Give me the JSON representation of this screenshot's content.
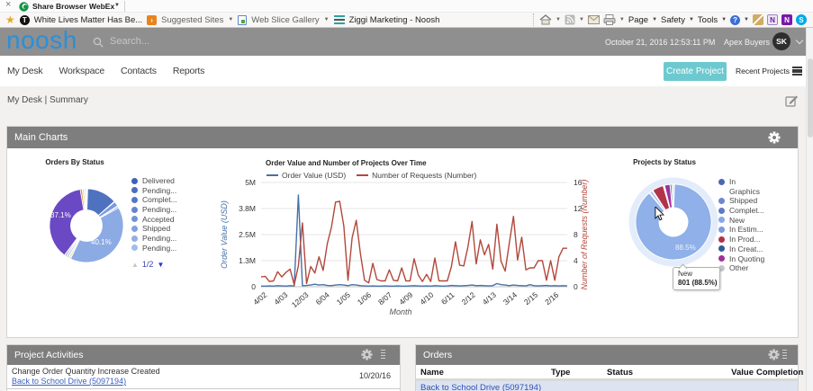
{
  "webex_bar": {
    "close_icon": "×",
    "share_label": "Share Browser",
    "menu_label": "WebEx"
  },
  "favorites_bar": {
    "fav1": "White Lives Matter Has Be...",
    "fav2": "Suggested Sites",
    "fav3": "Web Slice Gallery",
    "fav4": "Ziggi Marketing - Noosh"
  },
  "command_bar": {
    "page": "Page",
    "safety": "Safety",
    "tools": "Tools"
  },
  "app_header": {
    "logo": "noosh",
    "search_placeholder": "Search...",
    "datetime": "October 21, 2016 12:53:11 PM",
    "account": "Apex Buyers",
    "avatar_initials": "SK"
  },
  "nav": {
    "items": [
      {
        "label": "My Desk"
      },
      {
        "label": "Workspace"
      },
      {
        "label": "Contacts"
      },
      {
        "label": "Reports"
      }
    ],
    "create_project": "Create Project",
    "recent_projects": "Recent Projects"
  },
  "breadcrumb": {
    "text": "My Desk | Summary"
  },
  "panels": {
    "main_charts": {
      "title": "Main Charts"
    },
    "project_activities": {
      "title": "Project Activities",
      "rows": [
        {
          "title": "Change Order Quantity Increase Created",
          "link": "Back to School Drive (5097194)",
          "date": "10/20/16"
        }
      ]
    },
    "orders": {
      "title": "Orders",
      "columns": [
        "Name",
        "Type",
        "Status",
        "Value",
        "Completion"
      ],
      "rows": [
        {
          "name": "Back to School Drive (5097194)"
        }
      ]
    }
  },
  "chart_data": [
    {
      "type": "pie",
      "title": "Orders By Status",
      "slices": [
        {
          "from": 2,
          "to": 49,
          "color": "#4e72c0"
        },
        {
          "from": 50,
          "to": 57.5,
          "color": "#7b99dd"
        },
        {
          "from": 58.5,
          "to": 61,
          "color": "#93aee6"
        },
        {
          "from": 61,
          "to": 205.4,
          "color": "#8caae4",
          "label": "40.1%"
        },
        {
          "from": 206.4,
          "to": 208.6,
          "color": "#e3c84b"
        },
        {
          "from": 209.6,
          "to": 212.6,
          "color": "#b9c9ee"
        },
        {
          "from": 213.6,
          "to": 215.6,
          "color": "#3b4f86"
        },
        {
          "from": 216.6,
          "to": 350.2,
          "color": "#6b48c4",
          "label": "37.1%"
        },
        {
          "from": 350.2,
          "to": 353.2,
          "color": "#df8e3c"
        },
        {
          "from": 353.8,
          "to": 356,
          "color": "#e7c84e"
        },
        {
          "from": 356.6,
          "to": 358.6,
          "color": "#cfcfcf"
        }
      ],
      "legend": [
        {
          "label": "Delivered",
          "color": "#3f63b4"
        },
        {
          "label": "Pending...",
          "color": "#4a6fbf"
        },
        {
          "label": "Complet...",
          "color": "#5578c6"
        },
        {
          "label": "Pending...",
          "color": "#6585cf"
        },
        {
          "label": "Accepted",
          "color": "#7493d7"
        },
        {
          "label": "Shipped",
          "color": "#82a0dd"
        },
        {
          "label": "Pending...",
          "color": "#93afe5"
        },
        {
          "label": "Pending...",
          "color": "#a2bceb"
        }
      ],
      "pagination": {
        "page": "1/2"
      }
    },
    {
      "type": "line",
      "title": "Order Value and Number of Projects Over Time",
      "xlabel": "Month",
      "x_labels": [
        "4/02",
        "4/03",
        "12/03",
        "6/04",
        "1/05",
        "1/06",
        "8/07",
        "4/09",
        "4/10",
        "6/11",
        "2/12",
        "4/13",
        "3/14",
        "2/15",
        "2/16"
      ],
      "left_axis": {
        "title": "Order Value (USD)",
        "ticks": [
          "0",
          "1.3M",
          "2.5M",
          "3.8M",
          "5M"
        ],
        "max": 5,
        "color": "#4572a7"
      },
      "right_axis": {
        "title": "Number of Requests (Number)",
        "ticks": [
          "0",
          "4",
          "8",
          "12",
          "16"
        ],
        "max": 16,
        "color": "#b2483c"
      },
      "series": [
        {
          "name": "Order Value (USD)",
          "color": "#4572a7",
          "axis": "left",
          "values": [
            0.03,
            0.03,
            0.04,
            0.03,
            0.05,
            0.04,
            0.03,
            0.05,
            0.04,
            4.4,
            0.05,
            0.06,
            0.08,
            0.12,
            0.08,
            0.1,
            0.06,
            0.05,
            0.08,
            0.1,
            0.08,
            0.05,
            0.1,
            0.08,
            0.05,
            0.04,
            0.03,
            0.04,
            0.03,
            0.03,
            0.04,
            0.03,
            0.03,
            0.04,
            0.03,
            0.03,
            0.04,
            0.05,
            0.04,
            0.03,
            0.04,
            0.03,
            0.05,
            0.04,
            0.03,
            0.04,
            0.06,
            0.05,
            0.04,
            0.05,
            0.06,
            0.08,
            0.05,
            0.06,
            0.05,
            0.04,
            0.05,
            0.15,
            0.1,
            0.08,
            0.05,
            0.08,
            0.06,
            0.05,
            0.04,
            0.1,
            0.05,
            0.04,
            0.05,
            0.06,
            0.04,
            0.05,
            0.04,
            0.05,
            0.04
          ]
        },
        {
          "name": "Number of Requests (Number)",
          "color": "#b2483c",
          "axis": "right",
          "values": [
            1.5,
            1.6,
            0.8,
            0.9,
            2.3,
            1.5,
            2.2,
            2.7,
            0.3,
            3.2,
            9.8,
            0.5,
            3.1,
            2.1,
            4.6,
            2.5,
            6.6,
            9.1,
            13.0,
            13.1,
            9.3,
            1.0,
            7.5,
            10.2,
            5.1,
            1.0,
            0.6,
            3.6,
            1.1,
            0.9,
            0.9,
            2.6,
            1.0,
            0.9,
            2.9,
            0.9,
            0.9,
            4.3,
            1.8,
            0.8,
            1.9,
            0.8,
            4.4,
            0.9,
            0.9,
            0.9,
            3.1,
            6.9,
            3.3,
            3.2,
            6.1,
            10.0,
            3.5,
            7.2,
            4.9,
            6.5,
            2.7,
            9.6,
            3.9,
            2.4,
            6.7,
            10.8,
            4.1,
            7.6,
            2.6,
            2.9,
            2.9,
            4.0,
            4.0,
            1.0,
            4.0,
            1.0,
            4.6,
            5.9,
            5.9
          ]
        }
      ]
    },
    {
      "type": "pie",
      "title": "Projects by Status",
      "slices": [
        {
          "from": 1.5,
          "to": 320.1,
          "color": "#8fb0e8",
          "label": "88.5%"
        },
        {
          "from": 321.5,
          "to": 325.5,
          "color": "#aac3f0"
        },
        {
          "from": 327,
          "to": 344,
          "color": "#b23349"
        },
        {
          "from": 346.5,
          "to": 354.5,
          "color": "#a0309a"
        },
        {
          "from": 355,
          "to": 357.3,
          "color": "#2d5c99"
        },
        {
          "from": 357.8,
          "to": 360.2,
          "color": "#c9c9c9"
        }
      ],
      "legend": [
        {
          "label": "In",
          "label2": "Graphics",
          "color": "#4b66b4"
        },
        {
          "label": "Shipped",
          "color": "#6e87d0"
        },
        {
          "label": "Complet...",
          "color": "#5e7ac6"
        },
        {
          "label": "New",
          "color": "#89a8e6"
        },
        {
          "label": "In Estim...",
          "color": "#7e9ade"
        },
        {
          "label": "In Prod...",
          "color": "#b23349"
        },
        {
          "label": "In Creat...",
          "color": "#2d5c99"
        },
        {
          "label": "In Quoting",
          "color": "#a0309a"
        },
        {
          "label": "Other",
          "color": "#c4c8cc"
        }
      ],
      "tooltip": {
        "line1": "New",
        "line2": "801 (88.5%)"
      }
    }
  ]
}
